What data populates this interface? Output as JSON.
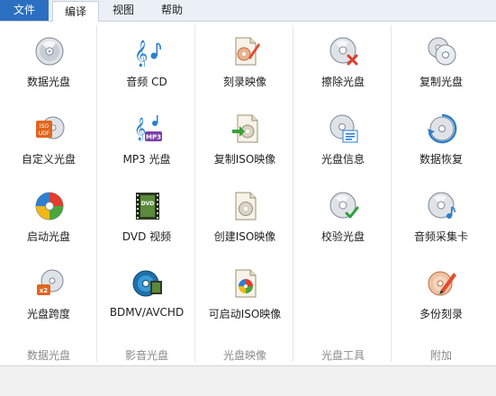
{
  "menu": {
    "file": "文件",
    "tabs": [
      "编译",
      "视图",
      "帮助"
    ]
  },
  "columns": [
    {
      "group": "数据光盘",
      "items": [
        {
          "label": "数据光盘",
          "icon": "data-disc-icon"
        },
        {
          "label": "自定义光盘",
          "icon": "iso-udf-disc-icon"
        },
        {
          "label": "启动光盘",
          "icon": "boot-disc-icon"
        },
        {
          "label": "光盘跨度",
          "icon": "disc-spanning-icon"
        }
      ]
    },
    {
      "group": "影音光盘",
      "items": [
        {
          "label": "音频 CD",
          "icon": "audio-cd-icon"
        },
        {
          "label": "MP3 光盘",
          "icon": "mp3-disc-icon"
        },
        {
          "label": "DVD 视频",
          "icon": "dvd-video-icon"
        },
        {
          "label": "BDMV/AVCHD",
          "icon": "bdmv-disc-icon"
        }
      ]
    },
    {
      "group": "光盘映像",
      "items": [
        {
          "label": "刻录映像",
          "icon": "burn-image-icon"
        },
        {
          "label": "复制ISO映像",
          "icon": "copy-iso-icon"
        },
        {
          "label": "创建ISO映像",
          "icon": "create-iso-icon"
        },
        {
          "label": "可启动ISO映像",
          "icon": "bootable-iso-icon"
        }
      ]
    },
    {
      "group": "光盘工具",
      "items": [
        {
          "label": "擦除光盘",
          "icon": "erase-disc-icon"
        },
        {
          "label": "光盘信息",
          "icon": "disc-info-icon"
        },
        {
          "label": "校验光盘",
          "icon": "verify-disc-icon"
        }
      ]
    },
    {
      "group": "附加",
      "items": [
        {
          "label": "复制光盘",
          "icon": "copy-disc-icon"
        },
        {
          "label": "数据恢复",
          "icon": "data-recovery-icon"
        },
        {
          "label": "音频采集卡",
          "icon": "audio-grabber-icon"
        },
        {
          "label": "多份刻录",
          "icon": "multi-burn-icon"
        }
      ]
    }
  ],
  "badges": {
    "iso_udf": [
      "ISO",
      "UDF"
    ],
    "mp3": "MP3",
    "dvd": "DVD",
    "x2": "x2"
  }
}
